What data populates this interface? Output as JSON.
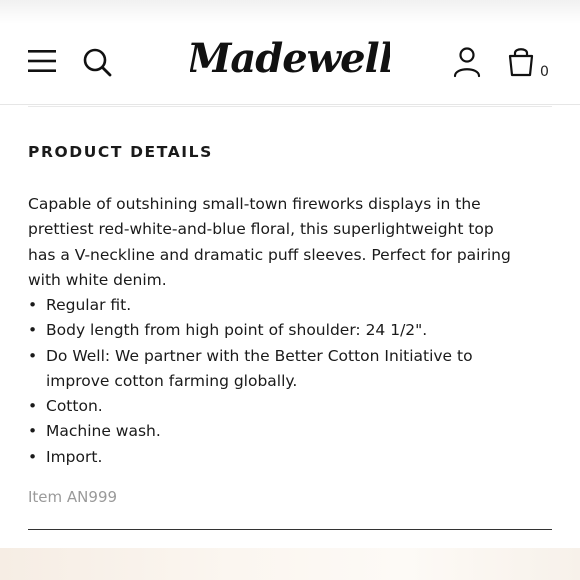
{
  "header": {
    "brand": "Madewell",
    "bag_count": "0",
    "icons": {
      "menu": "hamburger-menu-icon",
      "search": "search-icon",
      "account": "user-icon",
      "bag": "shopping-bag-icon"
    }
  },
  "product_details": {
    "title": "PRODUCT DETAILS",
    "description_lines": [
      "Capable of outshining small-town fireworks displays in the",
      "prettiest red-white-and-blue floral, this superlightweight top",
      "has a V-neckline and dramatic puff sleeves. Perfect for pairing",
      "with white denim."
    ],
    "bullet_char": "•",
    "bullets": [
      [
        "Regular fit."
      ],
      [
        "Body length from high point of shoulder: 24 1/2\"."
      ],
      [
        "Do Well: We partner with the Better Cotton Initiative to",
        "improve cotton farming globally."
      ],
      [
        "Cotton."
      ],
      [
        "Machine wash."
      ],
      [
        "Import."
      ]
    ],
    "item_code": "Item AN999"
  },
  "colors": {
    "text": "#1a1a1a",
    "muted": "#9a9a9a",
    "divider": "#333333"
  }
}
